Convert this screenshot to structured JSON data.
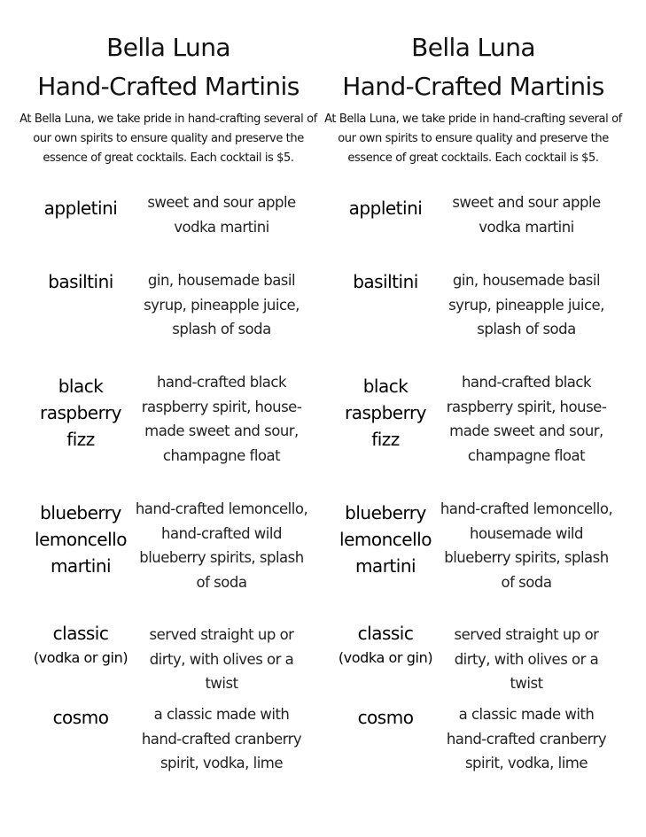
{
  "menus": [
    {
      "title_line1": "Bella Luna",
      "title_line2": "Hand-Crafted Martinis",
      "intro": "At Bella Luna, we take pride in hand-crafting several of our own spirits to ensure quality and preserve the essence of great cocktails. Each cocktail is $5.",
      "items": [
        {
          "name": "appletini",
          "sub": "",
          "description": "sweet and sour apple vodka martini"
        },
        {
          "name": "basiltini",
          "sub": "",
          "description": "gin, housemade basil syrup, pineapple juice, splash of soda"
        },
        {
          "name": "black raspberry fizz",
          "sub": "",
          "description": "hand-crafted black raspberry spirit, house-made sweet and sour, champagne float"
        },
        {
          "name": "blueberry lemoncello martini",
          "sub": "",
          "description": "hand-crafted lemoncello, hand-crafted wild blueberry spirits, splash of soda"
        },
        {
          "name": "classic",
          "sub": "(vodka or gin)",
          "description": "served straight up or dirty, with olives or a twist"
        },
        {
          "name": "cosmo",
          "sub": "",
          "description": "a classic made with hand-crafted cranberry spirit, vodka, lime"
        }
      ]
    },
    {
      "title_line1": "Bella Luna",
      "title_line2": "Hand-Crafted Martinis",
      "intro": "At Bella Luna, we take pride in hand-crafting several of our own spirits to ensure quality and preserve the essence of great cocktails. Each cocktail is $5.",
      "items": [
        {
          "name": "appletini",
          "sub": "",
          "description": "sweet and sour apple vodka martini"
        },
        {
          "name": "basiltini",
          "sub": "",
          "description": "gin, housemade basil syrup, pineapple juice, splash of soda"
        },
        {
          "name": "black raspberry fizz",
          "sub": "",
          "description": "hand-crafted black raspberry spirit, house-made sweet and sour, champagne float"
        },
        {
          "name": "blueberry lemoncello martini",
          "sub": "",
          "description": "hand-crafted lemoncello, housemade wild blueberry spirits, splash of soda"
        },
        {
          "name": "classic",
          "sub": "(vodka or gin)",
          "description": "served straight up or dirty, with olives or a twist"
        },
        {
          "name": "cosmo",
          "sub": "",
          "description": "a classic made with hand-crafted cranberry spirit, vodka, lime"
        }
      ]
    }
  ]
}
